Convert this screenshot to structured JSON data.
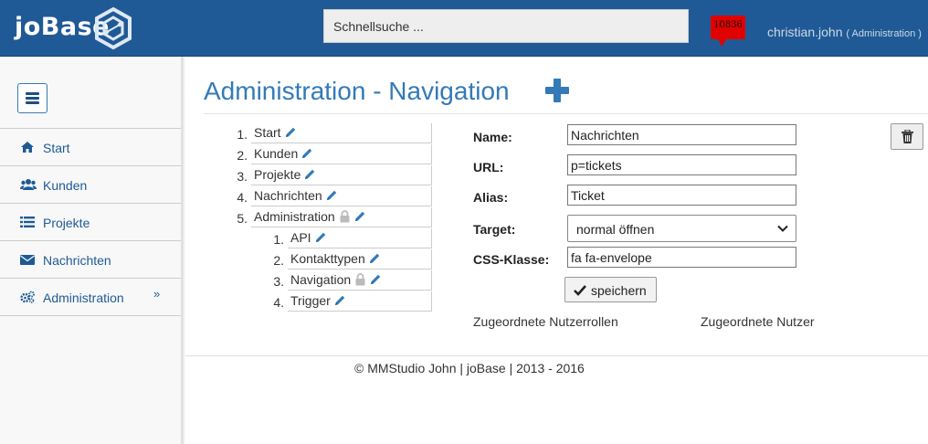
{
  "header": {
    "brand": "joBase",
    "search_placeholder": "Schnellsuche ...",
    "notification_count": "10836",
    "user_name": "christian.john",
    "user_role": "( Administration )"
  },
  "sidebar": {
    "items": [
      {
        "label": "Start",
        "icon": "home-icon"
      },
      {
        "label": "Kunden",
        "icon": "users-icon"
      },
      {
        "label": "Projekte",
        "icon": "list-icon"
      },
      {
        "label": "Nachrichten",
        "icon": "envelope-icon"
      },
      {
        "label": "Administration",
        "icon": "cogs-icon",
        "chevron": "»"
      }
    ]
  },
  "page": {
    "title_part1": "Administration",
    "title_sep": "-",
    "title_part2": "Navigation"
  },
  "tree": {
    "items": [
      {
        "num": "1.",
        "label": "Start"
      },
      {
        "num": "2.",
        "label": "Kunden"
      },
      {
        "num": "3.",
        "label": "Projekte"
      },
      {
        "num": "4.",
        "label": "Nachrichten"
      },
      {
        "num": "5.",
        "label": "Administration",
        "locked": true
      }
    ],
    "children": [
      {
        "num": "1.",
        "label": "API"
      },
      {
        "num": "2.",
        "label": "Kontakttypen"
      },
      {
        "num": "3.",
        "label": "Navigation",
        "locked": true
      },
      {
        "num": "4.",
        "label": "Trigger"
      }
    ]
  },
  "form": {
    "name_label": "Name:",
    "name_value": "Nachrichten",
    "url_label": "URL:",
    "url_value": "p=tickets",
    "alias_label": "Alias:",
    "alias_value": "Ticket",
    "target_label": "Target:",
    "target_value": "normal öffnen",
    "css_label": "CSS-Klasse:",
    "css_value": "fa fa-envelope",
    "save_label": "speichern",
    "roles_label": "Zugeordnete Nutzerrollen",
    "users_label": "Zugeordnete Nutzer"
  },
  "footer": {
    "text": "© MMStudio John | joBase | 2013 - 2016"
  },
  "colors": {
    "header_bg": "#1f5a96",
    "link": "#337ab7",
    "notification": "#e10000"
  }
}
